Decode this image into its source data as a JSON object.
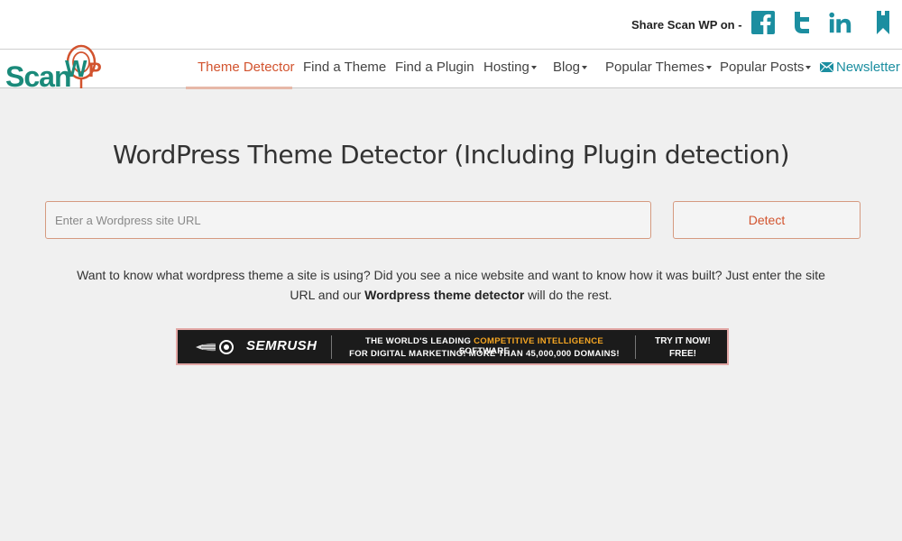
{
  "share": {
    "label": "Share Scan WP on -",
    "icons": [
      "facebook-icon",
      "twitter-icon",
      "linkedin-icon",
      "bookmark-icon"
    ],
    "color": "#1b8ea0"
  },
  "logo": {
    "text": "Scan",
    "wp_text": "WP",
    "text_color": "#1a8a7a",
    "accent_color": "#d2532e"
  },
  "nav": {
    "items": [
      {
        "label": "Theme Detector",
        "active": true,
        "dropdown": false
      },
      {
        "label": "Find a Theme",
        "active": false,
        "dropdown": false
      },
      {
        "label": "Find a Plugin",
        "active": false,
        "dropdown": false
      },
      {
        "label": "Hosting",
        "active": false,
        "dropdown": true
      },
      {
        "label": "Blog",
        "active": false,
        "dropdown": true
      },
      {
        "label": "Popular Themes",
        "active": false,
        "dropdown": true
      },
      {
        "label": "Popular Posts",
        "active": false,
        "dropdown": true
      },
      {
        "label": "Newsletter",
        "active": false,
        "dropdown": false,
        "icon": "mail-icon"
      }
    ],
    "active_color": "#d2532e",
    "newsletter_color": "#1b8ea0"
  },
  "main": {
    "title": "WordPress Theme Detector (Including Plugin detection)",
    "url_input": {
      "placeholder": "Enter a Wordpress site URL",
      "value": ""
    },
    "detect_label": "Detect",
    "description_part1": "Want to know what wordpress theme a site is using? Did you see a nice website and want to know how it was built? Just enter the site URL and our ",
    "description_bold": "Wordpress theme detector",
    "description_part2": " will do the rest."
  },
  "ad": {
    "brand": "SEMRUSH",
    "line1_prefix": "THE WORLD'S LEADING ",
    "line1_highlight": "COMPETITIVE INTELLIGENCE",
    "line1_suffix": " SOFTWARE",
    "line2": "FOR DIGITAL MARKETING! MORE THAN 45,000,000 DOMAINS!",
    "cta_line1": "TRY IT NOW!",
    "cta_line2": "FREE!",
    "highlight_color": "#f5a623"
  }
}
